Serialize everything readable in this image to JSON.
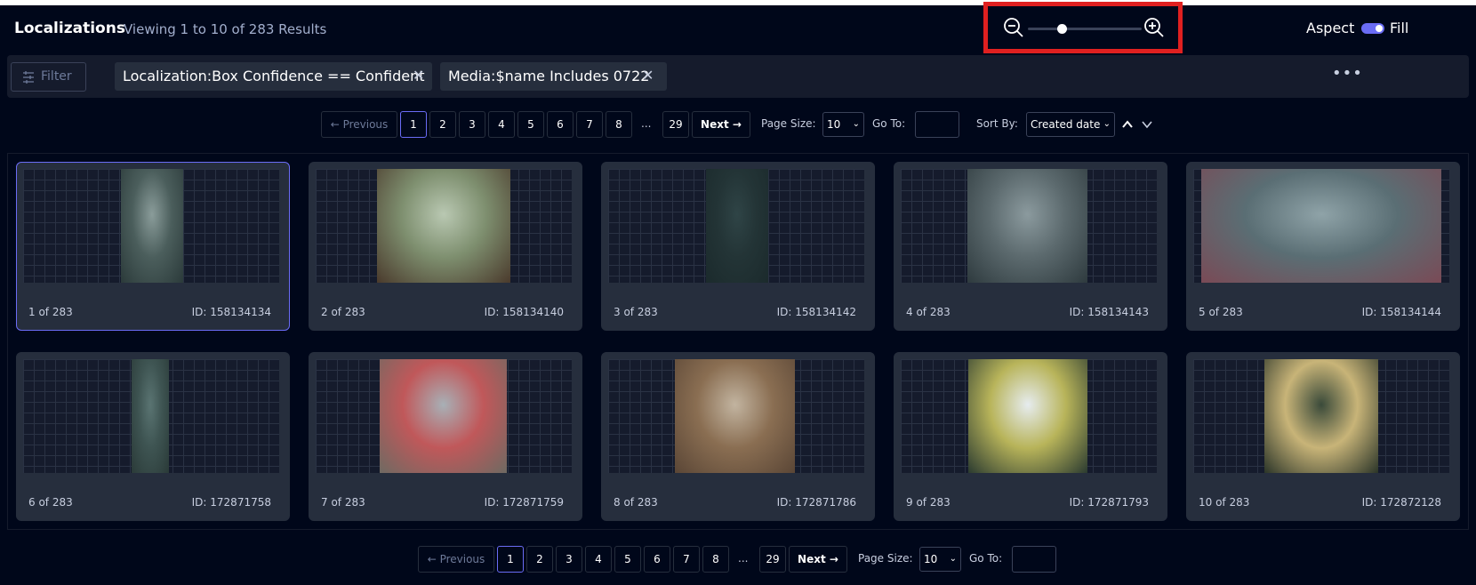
{
  "header": {
    "title": "Localizations",
    "subtitle": "Viewing 1 to 10 of 283 Results",
    "aspect_label": "Aspect",
    "fill_label": "Fill",
    "zoom_level": 0.3
  },
  "filterbar": {
    "filter_label": "Filter",
    "chips": [
      {
        "label": "Localization:Box Confidence == Confident"
      },
      {
        "label": "Media:$name Includes 0722"
      }
    ],
    "more_label": "•••"
  },
  "pagination": {
    "previous": "← Previous",
    "pages": [
      "1",
      "2",
      "3",
      "4",
      "5",
      "6",
      "7",
      "8"
    ],
    "ellipsis": "...",
    "last": "29",
    "next": "Next →",
    "page_size_label": "Page Size:",
    "page_size_value": "10",
    "goto_label": "Go To:",
    "sort_label": "Sort By:",
    "sort_value": "Created date"
  },
  "cards": [
    {
      "index": "1 of 283",
      "id": "ID: 158134134",
      "colors": [
        "#8a9c9a",
        "#4b5e5c",
        "#2b3a3a"
      ]
    },
    {
      "index": "2 of 283",
      "id": "ID: 158134140",
      "colors": [
        "#b9c8b2",
        "#7e8f6f",
        "#4a3a2c"
      ]
    },
    {
      "index": "3 of 283",
      "id": "ID: 158134142",
      "colors": [
        "#2f4446",
        "#233436",
        "#1b2a2c"
      ]
    },
    {
      "index": "4 of 283",
      "id": "ID: 158134143",
      "colors": [
        "#8b9a9e",
        "#5c6a6e",
        "#2e3a3e"
      ]
    },
    {
      "index": "5 of 283",
      "id": "ID: 158134144",
      "colors": [
        "#8fa3a8",
        "#5a6e74",
        "#7a4a56"
      ]
    },
    {
      "index": "6 of 283",
      "id": "ID: 172871758",
      "colors": [
        "#5a7472",
        "#3e5452",
        "#2a3a38"
      ]
    },
    {
      "index": "7 of 283",
      "id": "ID: 172871759",
      "colors": [
        "#a8b0b6",
        "#c0585a",
        "#6e6a62"
      ]
    },
    {
      "index": "8 of 283",
      "id": "ID: 172871786",
      "colors": [
        "#c2b4a0",
        "#8a6e52",
        "#5a4636"
      ]
    },
    {
      "index": "9 of 283",
      "id": "ID: 172871793",
      "colors": [
        "#e6ecef",
        "#b8b45a",
        "#2a3a30"
      ]
    },
    {
      "index": "10 of 283",
      "id": "ID: 172872128",
      "colors": [
        "#3a4a3a",
        "#c8b478",
        "#2a3428"
      ]
    }
  ]
}
